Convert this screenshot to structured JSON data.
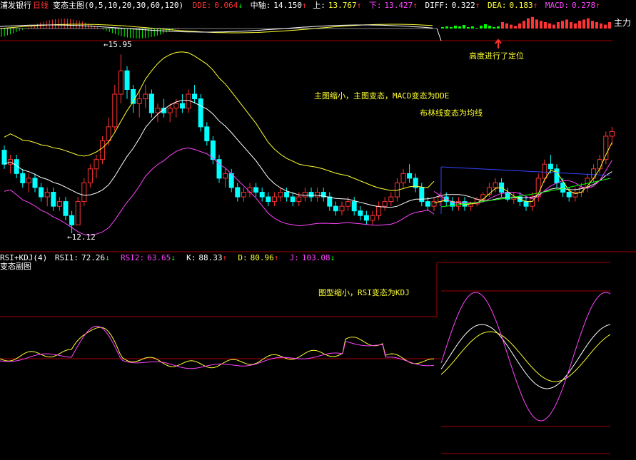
{
  "header": {
    "stock_name": "浦发银行",
    "period": "日线",
    "indicator_name": "变态主图",
    "indicator_params": "(0,5,10,20,30,60,120)",
    "dde_label": "DDE:",
    "dde_value": "0.064",
    "mid_label": "中轴:",
    "mid_value": "14.150",
    "upper_label": "上:",
    "upper_value": "13.767",
    "lower_label": "下:",
    "lower_value": "13.427",
    "diff_label": "DIFF:",
    "diff_value": "0.322",
    "dea_label": "DEA:",
    "dea_value": "0.183",
    "macd_label": "MACD:",
    "macd_value": "0.278",
    "main_force_label": "主力"
  },
  "annotations": {
    "height_positioned": "高度进行了定位",
    "main_shrink": "主图缩小，主图变态，MACD变态为DDE",
    "boll_to_ma": "布林线变态为均线",
    "sub_shrink": "图型缩小，RSI变态为KDJ",
    "high_price": "15.95",
    "low_price": "12.12"
  },
  "sub_header": {
    "indicator": "RSI+KDJ(4)",
    "rsi1_label": "RSI1:",
    "rsi1_value": "72.26",
    "rsi2_label": "RSI2:",
    "rsi2_value": "63.65",
    "k_label": "K:",
    "k_value": "88.33",
    "d_label": "D:",
    "d_value": "80.96",
    "j_label": "J:",
    "j_value": "103.08",
    "panel_name": "变态副图"
  },
  "colors": {
    "background": "#000000",
    "grid_line": "#a00000",
    "up": "#ff3333",
    "down": "#00ffff",
    "yellow": "#ffff33",
    "white": "#ffffff",
    "magenta": "#ff44ff",
    "green": "#00ff00",
    "blue": "#3344ff"
  },
  "chart_data": {
    "type": "candlestick",
    "candles": [
      [
        13.9,
        14.0,
        13.5,
        13.6
      ],
      [
        13.6,
        13.8,
        13.4,
        13.7
      ],
      [
        13.7,
        13.8,
        13.3,
        13.4
      ],
      [
        13.4,
        13.5,
        13.1,
        13.2
      ],
      [
        13.2,
        13.4,
        13.0,
        13.3
      ],
      [
        13.3,
        13.4,
        13.0,
        13.1
      ],
      [
        13.1,
        13.2,
        12.8,
        12.9
      ],
      [
        12.9,
        13.1,
        12.7,
        13.0
      ],
      [
        13.0,
        13.1,
        12.6,
        12.7
      ],
      [
        12.7,
        12.9,
        12.6,
        12.8
      ],
      [
        12.8,
        12.9,
        12.4,
        12.5
      ],
      [
        12.5,
        12.6,
        12.12,
        12.3
      ],
      [
        12.3,
        12.9,
        12.3,
        12.8
      ],
      [
        12.8,
        13.3,
        12.7,
        13.2
      ],
      [
        13.2,
        13.6,
        13.1,
        13.5
      ],
      [
        13.5,
        13.8,
        13.3,
        13.7
      ],
      [
        13.7,
        14.2,
        13.6,
        14.1
      ],
      [
        14.1,
        14.6,
        14.0,
        14.4
      ],
      [
        14.4,
        15.3,
        14.3,
        15.1
      ],
      [
        15.1,
        15.95,
        14.9,
        15.6
      ],
      [
        15.6,
        15.7,
        15.0,
        15.2
      ],
      [
        15.2,
        15.3,
        14.7,
        14.9
      ],
      [
        14.9,
        15.2,
        14.6,
        15.0
      ],
      [
        15.0,
        15.3,
        14.8,
        15.1
      ],
      [
        15.1,
        15.2,
        14.6,
        14.7
      ],
      [
        14.7,
        14.9,
        14.5,
        14.8
      ],
      [
        14.8,
        15.0,
        14.6,
        14.7
      ],
      [
        14.7,
        14.9,
        14.5,
        14.8
      ],
      [
        14.8,
        15.0,
        14.6,
        14.9
      ],
      [
        14.9,
        15.1,
        14.7,
        14.8
      ],
      [
        14.8,
        15.2,
        14.7,
        15.1
      ],
      [
        15.1,
        15.3,
        14.9,
        15.0
      ],
      [
        15.0,
        15.1,
        14.3,
        14.4
      ],
      [
        14.4,
        14.5,
        14.0,
        14.1
      ],
      [
        14.1,
        14.2,
        13.6,
        13.7
      ],
      [
        13.7,
        13.8,
        13.2,
        13.3
      ],
      [
        13.3,
        13.5,
        13.1,
        13.4
      ],
      [
        13.4,
        13.5,
        13.0,
        13.1
      ],
      [
        13.1,
        13.2,
        12.8,
        12.9
      ],
      [
        12.9,
        13.1,
        12.8,
        13.0
      ],
      [
        13.0,
        13.2,
        12.9,
        13.1
      ],
      [
        13.1,
        13.2,
        12.9,
        13.0
      ],
      [
        13.0,
        13.1,
        12.8,
        12.9
      ],
      [
        12.9,
        13.0,
        12.7,
        12.8
      ],
      [
        12.8,
        13.0,
        12.7,
        12.9
      ],
      [
        12.9,
        13.1,
        12.8,
        13.0
      ],
      [
        13.0,
        13.1,
        12.8,
        12.9
      ],
      [
        12.9,
        13.0,
        12.7,
        12.8
      ],
      [
        12.8,
        13.0,
        12.7,
        12.9
      ],
      [
        12.9,
        13.1,
        12.8,
        13.0
      ],
      [
        13.0,
        13.1,
        12.8,
        12.9
      ],
      [
        12.9,
        13.1,
        12.8,
        13.0
      ],
      [
        13.0,
        13.1,
        12.8,
        12.9
      ],
      [
        12.9,
        13.0,
        12.6,
        12.7
      ],
      [
        12.7,
        12.8,
        12.5,
        12.6
      ],
      [
        12.6,
        12.8,
        12.5,
        12.7
      ],
      [
        12.7,
        12.9,
        12.6,
        12.8
      ],
      [
        12.8,
        12.9,
        12.5,
        12.6
      ],
      [
        12.6,
        12.7,
        12.4,
        12.5
      ],
      [
        12.5,
        12.6,
        12.3,
        12.4
      ],
      [
        12.4,
        12.6,
        12.3,
        12.5
      ],
      [
        12.5,
        12.8,
        12.4,
        12.7
      ],
      [
        12.7,
        12.9,
        12.6,
        12.8
      ],
      [
        12.8,
        13.0,
        12.7,
        12.9
      ],
      [
        12.9,
        13.3,
        12.8,
        13.2
      ],
      [
        13.2,
        13.5,
        13.1,
        13.4
      ],
      [
        13.4,
        13.6,
        13.2,
        13.3
      ],
      [
        13.3,
        13.4,
        13.0,
        13.1
      ],
      [
        13.1,
        13.2,
        12.7,
        12.8
      ],
      [
        12.8,
        12.9,
        12.6,
        12.7
      ],
      [
        12.7,
        12.9,
        12.6,
        12.8
      ],
      [
        12.8,
        13.0,
        12.7,
        12.9
      ],
      [
        12.9,
        13.0,
        12.7,
        12.8
      ],
      [
        12.8,
        12.9,
        12.6,
        12.7
      ],
      [
        12.7,
        12.9,
        12.6,
        12.8
      ],
      [
        12.8,
        12.9,
        12.6,
        12.7
      ],
      [
        12.7,
        12.8,
        12.6,
        12.75
      ],
      [
        12.75,
        12.9,
        12.7,
        12.85
      ],
      [
        12.85,
        13.0,
        12.8,
        12.95
      ],
      [
        12.95,
        13.2,
        12.9,
        13.1
      ],
      [
        13.1,
        13.3,
        13.0,
        13.2
      ],
      [
        13.2,
        13.3,
        12.9,
        13.0
      ],
      [
        13.0,
        13.1,
        12.8,
        12.85
      ],
      [
        12.85,
        13.0,
        12.75,
        12.9
      ],
      [
        12.9,
        13.0,
        12.7,
        12.8
      ],
      [
        12.8,
        12.9,
        12.6,
        12.7
      ],
      [
        12.7,
        13.0,
        12.6,
        12.9
      ],
      [
        12.9,
        13.4,
        12.8,
        13.3
      ],
      [
        13.3,
        13.7,
        13.2,
        13.6
      ],
      [
        13.6,
        13.8,
        13.4,
        13.5
      ],
      [
        13.5,
        13.6,
        13.1,
        13.2
      ],
      [
        13.2,
        13.3,
        12.9,
        13.0
      ],
      [
        13.0,
        13.1,
        12.8,
        12.9
      ],
      [
        12.9,
        13.1,
        12.8,
        13.0
      ],
      [
        13.0,
        13.2,
        12.9,
        13.1
      ],
      [
        13.1,
        13.4,
        13.0,
        13.3
      ],
      [
        13.3,
        13.6,
        13.2,
        13.5
      ],
      [
        13.5,
        13.8,
        13.4,
        13.7
      ],
      [
        13.7,
        14.3,
        13.6,
        14.2
      ],
      [
        14.2,
        14.4,
        14.0,
        14.3
      ]
    ],
    "high_marker": "15.95",
    "low_marker": "12.12"
  }
}
